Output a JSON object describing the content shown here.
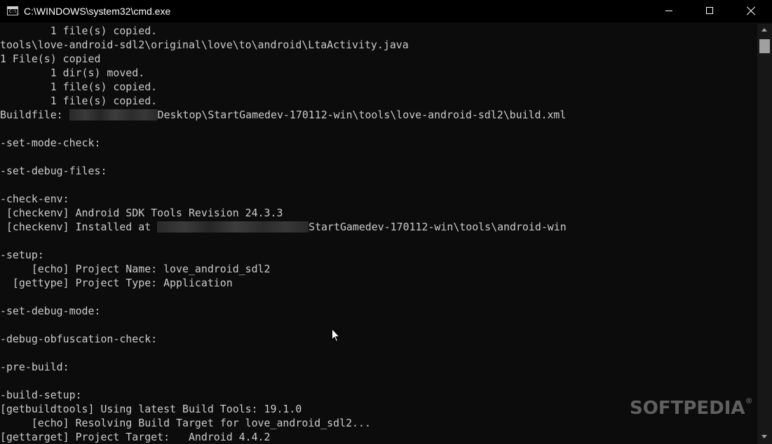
{
  "window": {
    "title": "C:\\WINDOWS\\system32\\cmd.exe",
    "icon_glyph": "C:\\_"
  },
  "console": {
    "line_prefix_buildfile": "Buildfile: ",
    "line_suffix_buildfile": "Desktop\\StartGamedev-170112-win\\tools\\love-android-sdl2\\build.xml",
    "line_prefix_installed": " [checkenv] Installed at ",
    "line_suffix_installed": "StartGamedev-170112-win\\tools\\android-win",
    "lines": [
      "        1 file(s) copied.",
      "tools\\love-android-sdl2\\original\\love\\to\\android\\LtaActivity.java",
      "1 File(s) copied",
      "        1 dir(s) moved.",
      "        1 file(s) copied.",
      "        1 file(s) copied.",
      "",
      "",
      "-set-mode-check:",
      "",
      "-set-debug-files:",
      "",
      "-check-env:",
      " [checkenv] Android SDK Tools Revision 24.3.3",
      "",
      "",
      "-setup:",
      "     [echo] Project Name: love_android_sdl2",
      "  [gettype] Project Type: Application",
      "",
      "-set-debug-mode:",
      "",
      "-debug-obfuscation-check:",
      "",
      "-pre-build:",
      "",
      "-build-setup:",
      "[getbuildtools] Using latest Build Tools: 19.1.0",
      "     [echo] Resolving Build Target for love_android_sdl2...",
      "[gettarget] Project Target:   Android 4.4.2"
    ]
  },
  "watermark": {
    "text": "SOFTPEDIA",
    "mark": "®"
  },
  "colors": {
    "console_bg": "#0c0c0c",
    "console_text": "#cccccc",
    "titlebar_bg": "#000000",
    "titlebar_text": "#ffffff"
  },
  "icons": {
    "app": "cmd-icon",
    "minimize": "minimize-icon",
    "maximize": "maximize-icon",
    "close": "close-icon",
    "cursor": "mouse-pointer-icon"
  }
}
